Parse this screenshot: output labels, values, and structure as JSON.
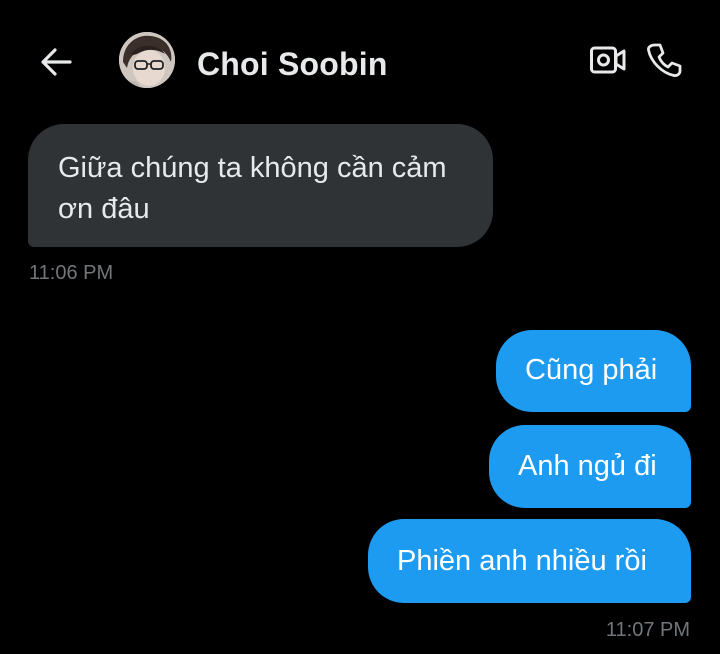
{
  "header": {
    "back_icon": "arrow-left-icon",
    "contact_name": "Choi Soobin",
    "video_icon": "video-camera-icon",
    "call_icon": "phone-icon"
  },
  "colors": {
    "background": "#000000",
    "incoming_bubble": "#2f3336",
    "outgoing_bubble": "#1d9bf0",
    "timestamp": "#71767b"
  },
  "messages": [
    {
      "direction": "incoming",
      "text": "Giữa chúng ta không cần cảm ơn đâu"
    },
    {
      "direction": "outgoing",
      "text": "Cũng phải"
    },
    {
      "direction": "outgoing",
      "text": "Anh ngủ đi"
    },
    {
      "direction": "outgoing",
      "text": "Phiền anh nhiều rồi"
    }
  ],
  "timestamps": [
    "11:06 PM",
    "11:07 PM"
  ]
}
